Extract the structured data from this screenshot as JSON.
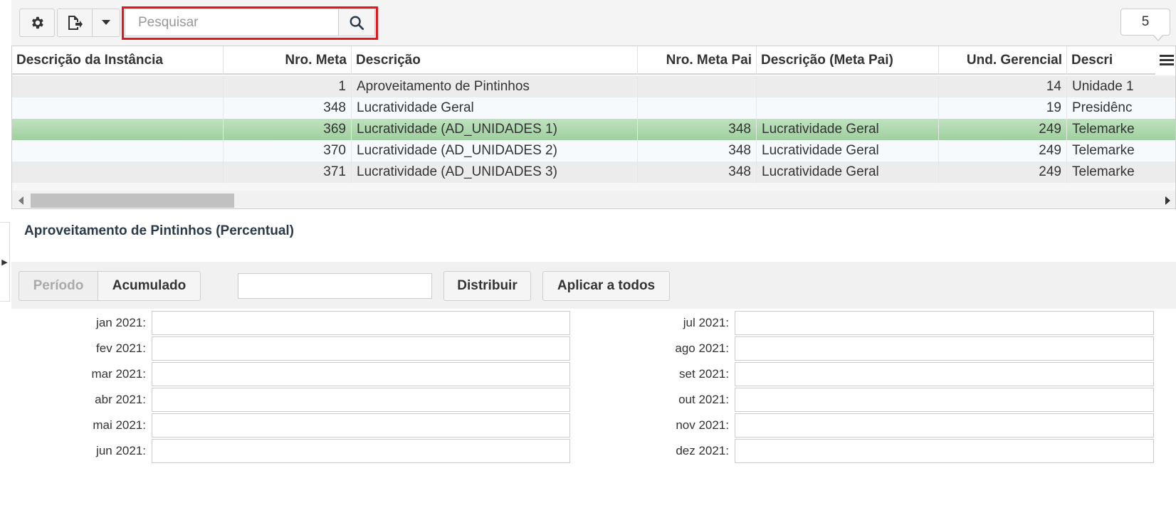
{
  "toolbar": {
    "settings_icon": "gear-icon",
    "export_icon": "export-file-icon",
    "dropdown_icon": "caret-down-icon",
    "search_placeholder": "Pesquisar",
    "search_value": "",
    "search_icon": "search-icon",
    "count": "5"
  },
  "grid": {
    "columns": [
      "Descrição da Instância",
      "Nro. Meta",
      "Descrição",
      "Nro. Meta Pai",
      "Descrição (Meta Pai)",
      "Und. Gerencial",
      "Descri"
    ],
    "rows": [
      {
        "instancia": "",
        "nro_meta": "1",
        "descricao": "Aproveitamento de Pintinhos",
        "nro_meta_pai": "",
        "descricao_pai": "",
        "und_gerencial": "14",
        "descricao_und": "Unidade 1"
      },
      {
        "instancia": "",
        "nro_meta": "348",
        "descricao": "Lucratividade Geral",
        "nro_meta_pai": "",
        "descricao_pai": "",
        "und_gerencial": "19",
        "descricao_und": "Presidênc"
      },
      {
        "instancia": "",
        "nro_meta": "369",
        "descricao": "Lucratividade (AD_UNIDADES 1)",
        "nro_meta_pai": "348",
        "descricao_pai": "Lucratividade Geral",
        "und_gerencial": "249",
        "descricao_und": "Telemarke"
      },
      {
        "instancia": "",
        "nro_meta": "370",
        "descricao": "Lucratividade (AD_UNIDADES 2)",
        "nro_meta_pai": "348",
        "descricao_pai": "Lucratividade Geral",
        "und_gerencial": "249",
        "descricao_und": "Telemarke"
      },
      {
        "instancia": "",
        "nro_meta": "371",
        "descricao": "Lucratividade (AD_UNIDADES 3)",
        "nro_meta_pai": "348",
        "descricao_pai": "Lucratividade Geral",
        "und_gerencial": "249",
        "descricao_und": "Telemarke"
      }
    ],
    "selected_row_color": "#a9d6a9"
  },
  "detail": {
    "title": "Aproveitamento de Pintinhos (Percentual)",
    "mode_periodo": "Período",
    "mode_acumulado": "Acumulado",
    "distribute_value": "",
    "distribute_label": "Distribuir",
    "apply_all_label": "Aplicar a todos",
    "months_left": [
      "jan 2021:",
      "fev 2021:",
      "mar 2021:",
      "abr 2021:",
      "mai 2021:",
      "jun 2021:"
    ],
    "months_right": [
      "jul 2021:",
      "ago 2021:",
      "set 2021:",
      "out 2021:",
      "nov 2021:",
      "dez 2021:"
    ]
  },
  "colors": {
    "search_highlight": "#e8151b",
    "row_even": "#ececec",
    "row_odd": "#f7fafd"
  }
}
